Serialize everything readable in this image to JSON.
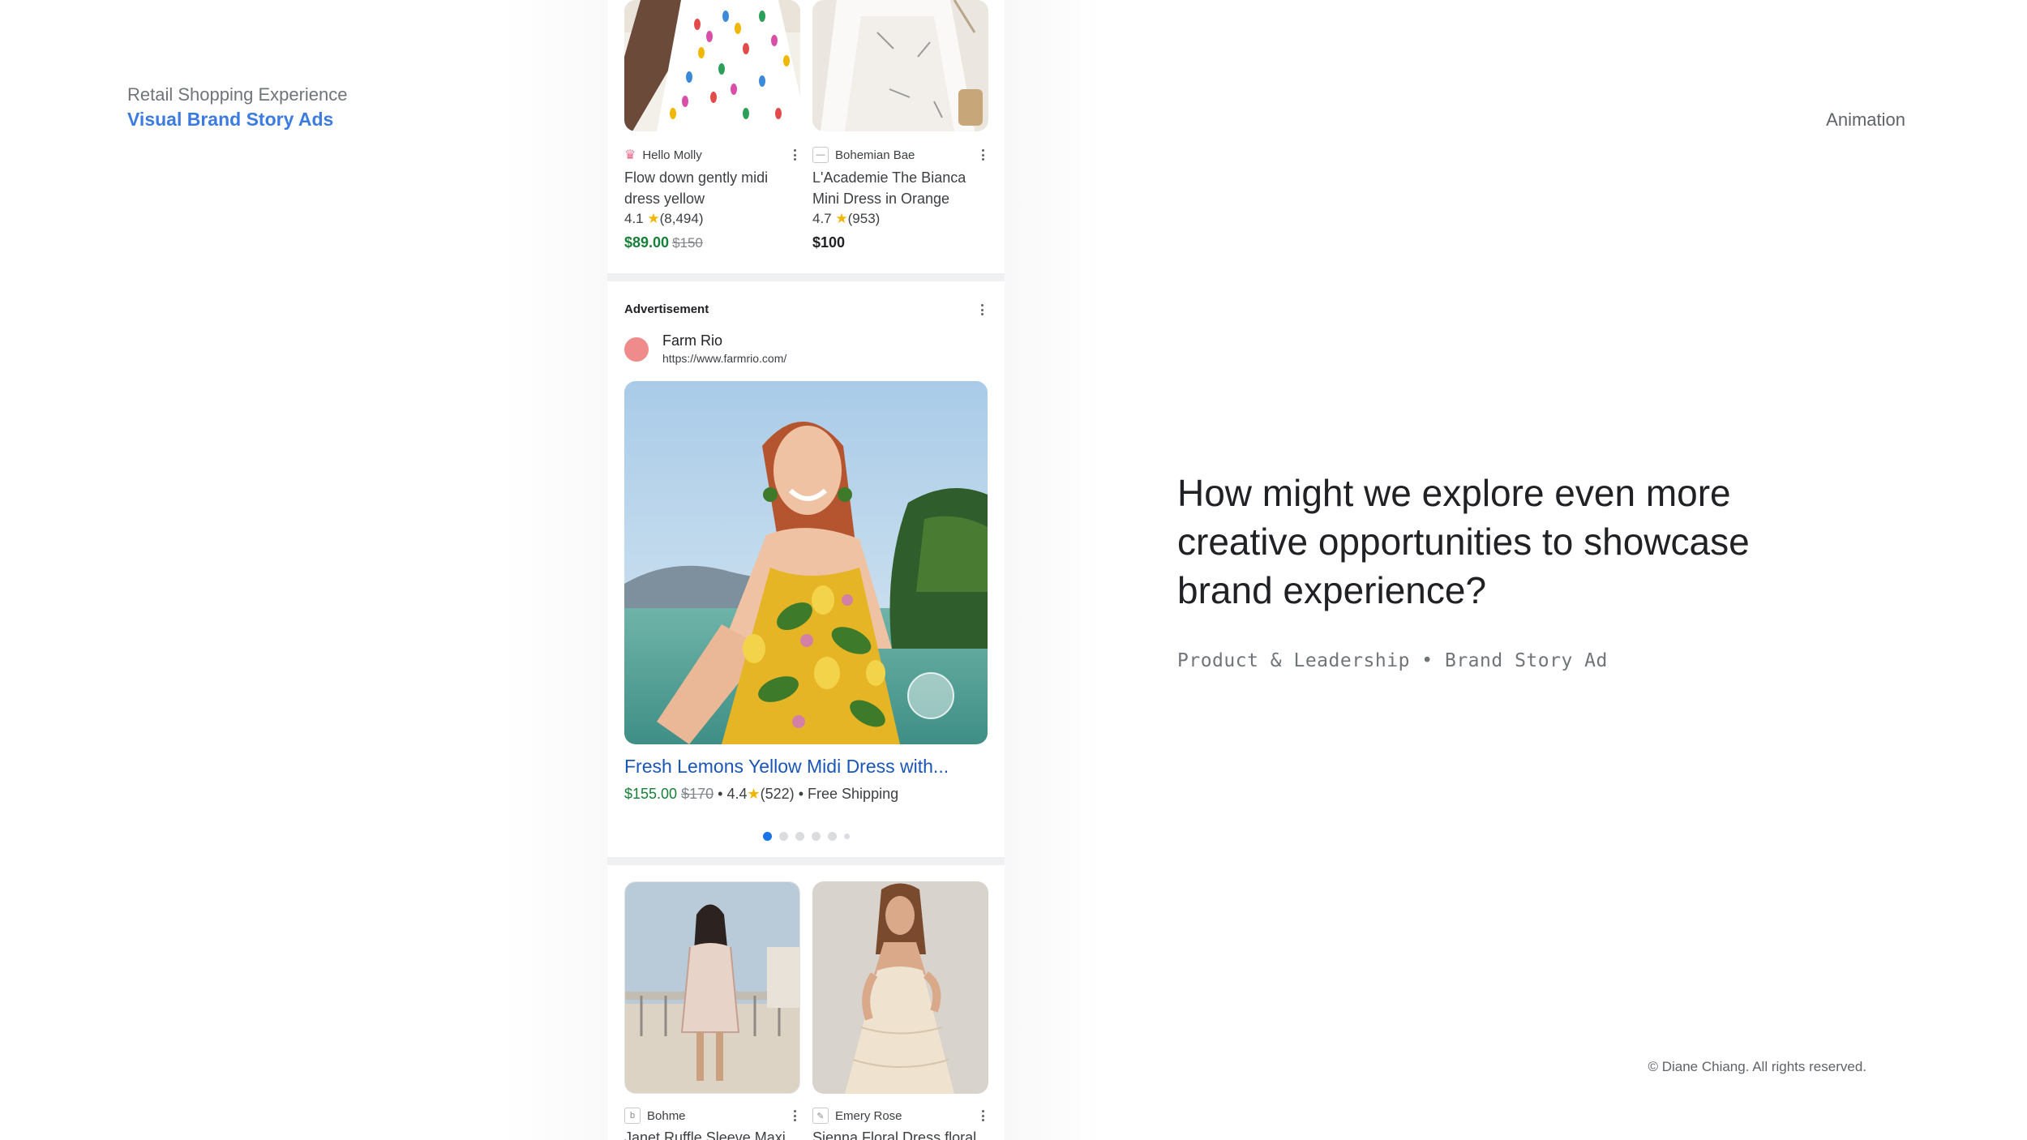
{
  "slide": {
    "eyebrow": "Retail Shopping Experience",
    "headline": "Visual Brand Story Ads",
    "section_label": "Animation",
    "question": "How might we explore even more creative opportunities to showcase brand experience?",
    "tagline": "Product & Leadership • Brand Story Ad",
    "copyright": "© Diane Chiang. All rights reserved."
  },
  "top_products": [
    {
      "seller": "Hello Molly",
      "title": "Flow down gently midi dress yellow",
      "rating": "4.1",
      "reviews": "(8,494)",
      "price": "$89.00",
      "old_price": "$150",
      "on_sale": true
    },
    {
      "seller": "Bohemian Bae",
      "title": "L'Academie The Bianca Mini Dress in Orange",
      "rating": "4.7",
      "reviews": "(953)",
      "price": "$100",
      "old_price": "",
      "on_sale": false
    }
  ],
  "ad": {
    "label": "Advertisement",
    "brand": "Farm Rio",
    "url": "https://www.farmrio.com/",
    "title": "Fresh Lemons Yellow Midi Dress with...",
    "price": "$155.00",
    "old_price": "$170",
    "rating": "4.4",
    "reviews": "(522)",
    "shipping": "Free Shipping",
    "carousel_count": 6,
    "carousel_active": 0
  },
  "bottom_products": [
    {
      "seller": "Bohme",
      "seller_logo": "b",
      "title": "Janet Ruffle Sleeve Maxi"
    },
    {
      "seller": "Emery Rose",
      "seller_logo": "",
      "title": "Sienna Floral Dress floral"
    }
  ],
  "colors": {
    "accent_blue": "#3c7be0",
    "link_blue": "#1a56b8",
    "sale_green": "#188038",
    "star": "#f4b400",
    "brand_dot": "#ef8b8b"
  },
  "icons": [
    "more-vert-icon",
    "star-icon",
    "seller-logo-icon"
  ]
}
